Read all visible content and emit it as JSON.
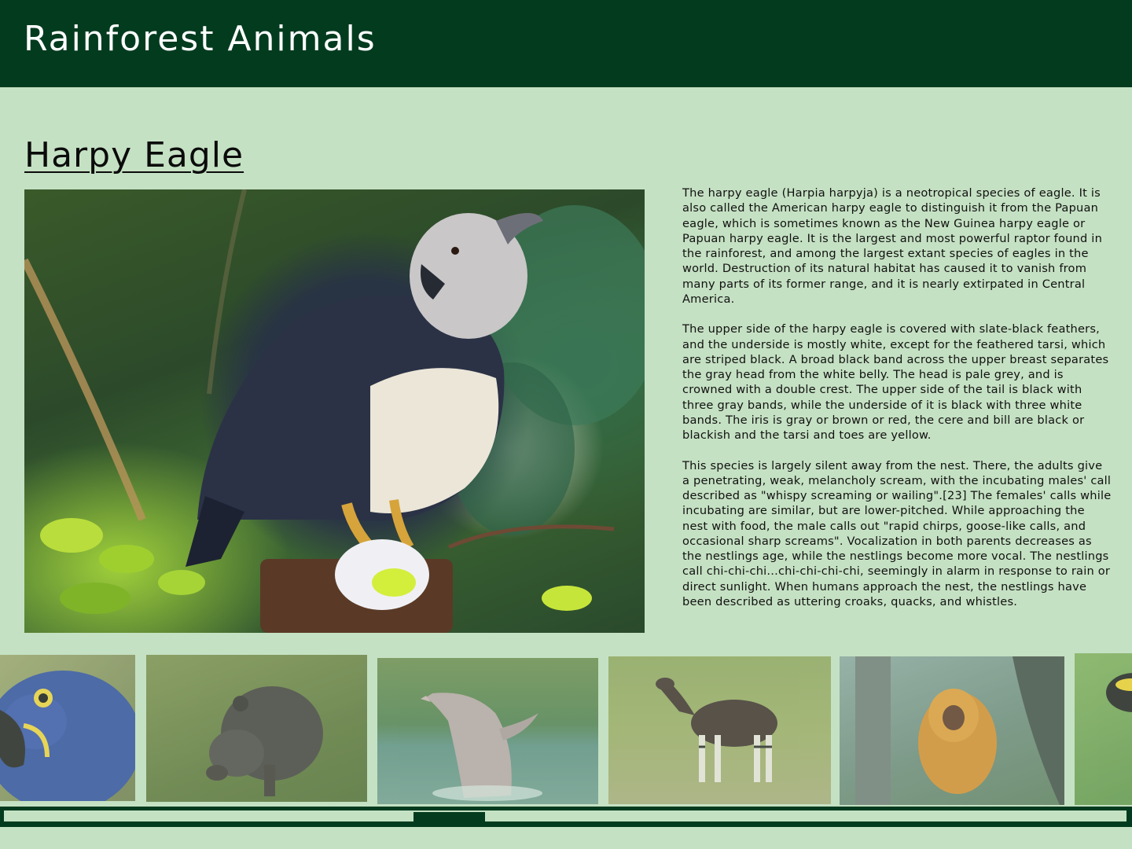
{
  "app": {
    "title": "Rainforest Animals"
  },
  "colors": {
    "header_bg": "#033b1f",
    "page_bg": "#c5e1c3",
    "scrollbar": "#033b1f"
  },
  "animal": {
    "name": "Harpy Eagle",
    "paragraphs": [
      "The harpy eagle (Harpia harpyja) is a neotropical species of eagle. It is also called the American harpy eagle to distinguish it from the Papuan eagle, which is sometimes known as the New Guinea harpy eagle or Papuan harpy eagle. It is the largest and most powerful raptor found in the rainforest, and among the largest extant species of eagles in the world. Destruction of its natural habitat has caused it to vanish from many parts of its former range, and it is nearly extirpated in Central America.",
      "The upper side of the harpy eagle is covered with slate-black feathers, and the underside is mostly white, except for the feathered tarsi, which are striped black. A broad black band across the upper breast separates the gray head from the white belly. The head is pale grey, and is crowned with a double crest. The upper side of the tail is black with three gray bands, while the underside of it is black with three white bands. The iris is gray or brown or red, the cere and bill are black or blackish and the tarsi and toes are yellow.",
      "This species is largely silent away from the nest. There, the adults give a penetrating, weak, melancholy scream, with the incubating males' call described as \"whispy screaming or wailing\".[23] The females' calls while incubating are similar, but are lower-pitched. While approaching the nest with food, the male calls out \"rapid chirps, goose-like calls, and occasional sharp screams\". Vocalization in both parents decreases as the nestlings age, while the nestlings become more vocal. The nestlings call chi-chi-chi...chi-chi-chi-chi, seemingly in alarm in response to rain or direct sunlight. When humans approach the nest, the nestlings have been described as uttering croaks, quacks, and whistles."
    ]
  },
  "carousel": {
    "items": [
      {
        "id": "hyacinth-macaw",
        "icon": "macaw-photo"
      },
      {
        "id": "tapir",
        "icon": "tapir-photo"
      },
      {
        "id": "river-dolphin",
        "icon": "dolphin-photo"
      },
      {
        "id": "okapi",
        "icon": "okapi-photo"
      },
      {
        "id": "golden-lion-tamarin",
        "icon": "tamarin-photo"
      },
      {
        "id": "poison-dart-frog",
        "icon": "frog-photo"
      }
    ],
    "scroll_position": 0.39
  }
}
